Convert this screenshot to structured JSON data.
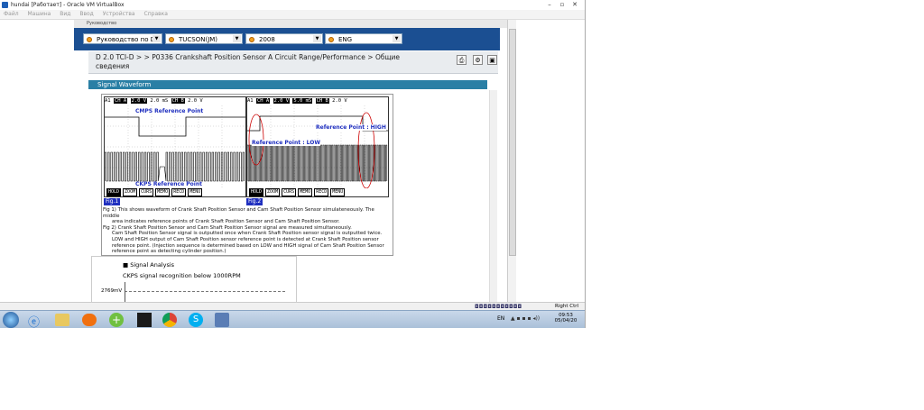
{
  "window": {
    "title": "hundai [Работает] - Oracle VM VirtualBox",
    "minimize": "–",
    "restore": "▫",
    "close": "✕"
  },
  "menubar": [
    "Файл",
    "Машина",
    "Вид",
    "Ввод",
    "Устройства",
    "Справка"
  ],
  "inner_title": "Руководство",
  "header": {
    "selects": [
      {
        "value": "Руководство по D`"
      },
      {
        "value": "TUCSON(JM)"
      },
      {
        "value": "2008"
      },
      {
        "value": "ENG"
      }
    ]
  },
  "breadcrumb": "D 2.0 TCI-D > > P0336 Crankshaft Position Sensor A Circuit Range/Performance > Общие сведения",
  "section_title": "Signal Waveform",
  "scope1": {
    "header": [
      "A1",
      "CH A",
      "2.0 V",
      "2.0 mS",
      "CH B",
      "2.0 V"
    ],
    "label_top": "CMPS Reference Point",
    "label_bottom": "CKPS Reference Point",
    "buttons": [
      "HOLD",
      "ZOOM",
      "CURS",
      "MEMO",
      "RECD",
      "MENU"
    ],
    "fig": "Fig.1"
  },
  "scope2": {
    "header": [
      "A1",
      "CH A",
      "2.0 V",
      "5.0 mS",
      "CH B",
      "2.0 V"
    ],
    "label_high": "Reference Point : HIGH",
    "label_low": "Reference Point : LOW",
    "buttons": [
      "HOLD",
      "ZOOM",
      "CURS",
      "MEMO",
      "RECD",
      "MENU"
    ],
    "fig": "Fig.2"
  },
  "captions": [
    "Fig 1) This shows waveform of Crank Shaft Position Sensor and Cam Shaft Position Sensor simulateneously. The middle",
    "area indicates reference points of Crank Shaft Position Sensor and Cam Shaft Position Sensor.",
    "Fig 2) Crank Shaft Position Sensor and Cam Shaft Position Sensor signal are measured simultaneously.",
    "Cam Shaft Position Sensor signal is outputted once when Crank Shaft Position sensor signal is outputted twice.",
    "LOW and HIGH output of Cam Shaft Position sensor reference point is detected at Crank Shaft Position sensor",
    "reference point. (Injection sequence is determined based on LOW and HIGH signal of Cam Shaft Position Sensor",
    "reference point as detecting cylinder position.)"
  ],
  "analysis": {
    "title": "Signal Analysis",
    "subtitle": "CKPS signal recognition below 1000RPM",
    "value": "2769mV"
  },
  "status": {
    "host_key": "Right Ctrl"
  },
  "tray": {
    "lang": "EN",
    "time": "09:53",
    "date": "05/04/20"
  },
  "colors": {
    "header": "#1b4f92",
    "section": "#2a7fa5",
    "label": "#1f2fbf"
  }
}
